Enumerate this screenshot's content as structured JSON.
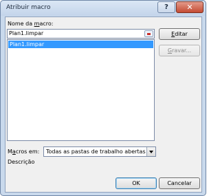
{
  "window": {
    "title": "Atribuir macro",
    "help_label": "?",
    "close_label": "✕"
  },
  "macro_name": {
    "label_pre": "Nome da ",
    "label_accel": "m",
    "label_post": "acro:",
    "value": "Plan1.limpar",
    "list_items": [
      "Plan1.limpar"
    ]
  },
  "buttons": {
    "edit_pre": "",
    "edit_accel": "E",
    "edit_post": "ditar",
    "record_pre": "",
    "record_accel": "G",
    "record_post": "ravar...",
    "ok": "OK",
    "cancel": "Cancelar"
  },
  "macros_in": {
    "label_pre": "M",
    "label_accel": "a",
    "label_post": "cros em:",
    "selected": "Todas as pastas de trabalho abertas"
  },
  "description": {
    "label": "Descrição"
  },
  "colors": {
    "selection": "#3399ff",
    "close_button": "#c44b33"
  }
}
